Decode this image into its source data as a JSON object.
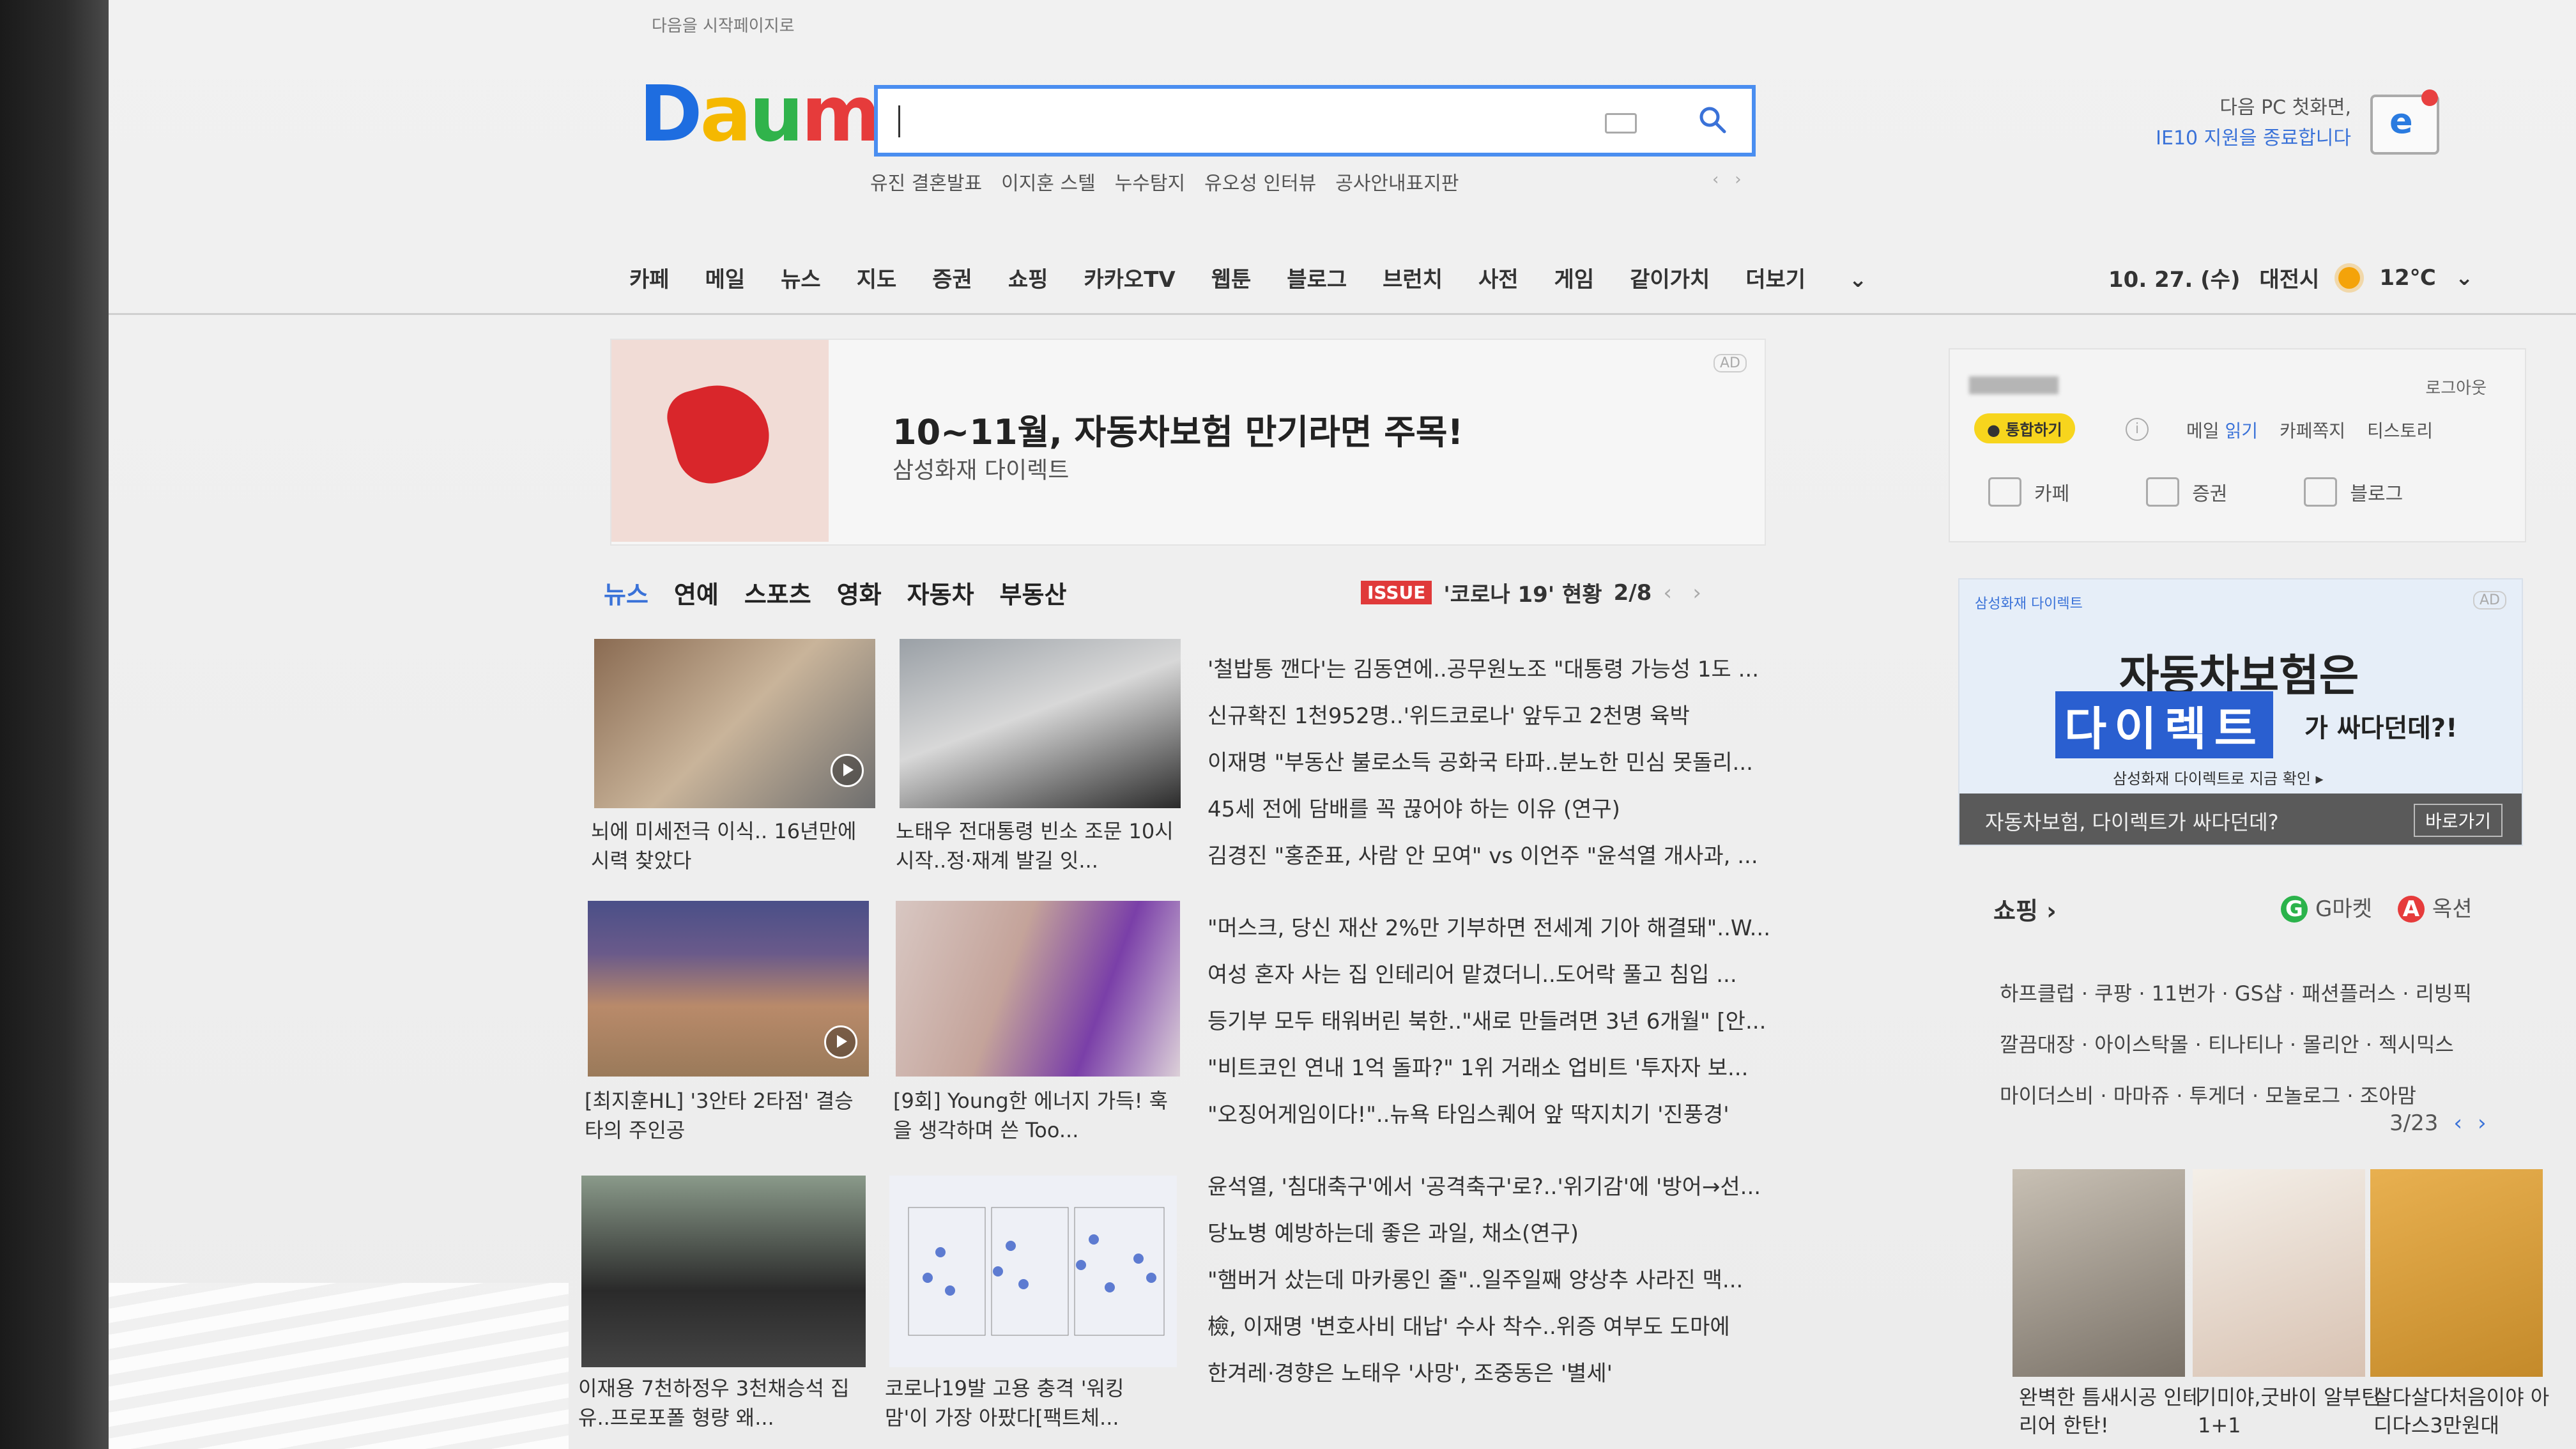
{
  "header": {
    "start_link": "다음을 시작페이지로",
    "logo_text": "Daum",
    "trending": [
      "유진 결혼발표",
      "이지훈 스텔",
      "누수탐지",
      "유오성 인터뷰",
      "공사안내표지판"
    ],
    "ie_notice_line1": "다음 PC 첫화면,",
    "ie_notice_line2": "IE10 지원을 종료합니다",
    "ie_icon_letter": "e"
  },
  "nav": {
    "items": [
      "카페",
      "메일",
      "뉴스",
      "지도",
      "증권",
      "쇼핑",
      "카카오TV",
      "웹툰",
      "블로그",
      "브런치",
      "사전",
      "게임",
      "같이가치",
      "더보기"
    ]
  },
  "weather": {
    "date": "10. 27. (수)",
    "location": "대전시",
    "temp": "12℃"
  },
  "ad_banner": {
    "title": "10~11월, 자동차보험 만기라면 주목!",
    "sub": "삼성화재 다이렉트",
    "badge": "AD"
  },
  "news_tabs": {
    "items": [
      "뉴스",
      "연예",
      "스포츠",
      "영화",
      "자동차",
      "부동산"
    ],
    "issue_badge": "ISSUE",
    "issue_text": "'코로나 19' 현황",
    "issue_page": "2/8"
  },
  "thumbs": [
    {
      "caption": "뇌에 미세전극 이식.. 16년만에 시력 찾았다"
    },
    {
      "caption": "노태우 전대통령 빈소 조문 10시 시작..정·재계 발길 잇..."
    },
    {
      "caption": "[최지훈HL] '3안타 2타점' 결승타의 주인공"
    },
    {
      "caption": "[9회] Young한 에너지 가득! 훅을 생각하며 쓴 Too..."
    },
    {
      "caption": "이재용 7천하정우 3천채승석 집유..프로포폴 형량 왜..."
    },
    {
      "caption": "코로나19발 고용 충격 '워킹맘'이 가장 아팠다[팩트체..."
    }
  ],
  "headlines": [
    "'철밥통 깬다'는 김동연에..공무원노조 \"대통령 가능성 1도 ...",
    "신규확진 1천952명..'위드코로나' 앞두고 2천명 육박",
    "이재명 \"부동산 불로소득 공화국 타파..분노한 민심 못돌리...",
    "45세 전에 담배를 꼭 끊어야 하는 이유 (연구)",
    "김경진 \"홍준표, 사람 안 모여\" vs 이언주 \"윤석열 개사과, ...",
    "\"머스크, 당신 재산 2%만 기부하면 전세계 기아 해결돼\"..W...",
    "여성 혼자 사는 집 인테리어 맡겼더니..도어락 풀고 침입 ...",
    "등기부 모두 태워버린 북한..\"새로 만들려면 3년 6개월\" [안...",
    "\"비트코인 연내 1억 돌파?\" 1위 거래소 업비트 '투자자 보...",
    "\"오징어게임이다!\"..뉴욕 타임스퀘어 앞 딱지치기 '진풍경'",
    "윤석열, '침대축구'에서 '공격축구'로?..'위기감'에 '방어→선...",
    "당뇨병 예방하는데 좋은 과일, 채소(연구)",
    "\"햄버거 샀는데 마카롱인 줄\"..일주일째 양상추 사라진 맥...",
    "檢, 이재명 '변호사비 대납' 수사 착수..위증 여부도 도마에",
    "한겨레·경향은 노태우 '사망', 조중동은 '별세'"
  ],
  "login_box": {
    "logout": "로그아웃",
    "integrate_btn": "통합하기",
    "info": "i",
    "mail_label": "메일",
    "mail_link": "읽기",
    "links": [
      "카페쪽지",
      "티스토리"
    ],
    "services": [
      "카페",
      "증권",
      "블로그"
    ]
  },
  "side_ad": {
    "brand": "삼성화재 다이렉트",
    "adtag": "AD",
    "headline1": "자동차보험은",
    "headline2": "다이렉트",
    "headline3": "가 싸다던데?!",
    "sub": "삼성화재 다이렉트로 지금 확인 ▸",
    "bar_text": "자동차보험, 다이렉트가 싸다던데?",
    "bar_btn": "바로가기"
  },
  "shopping": {
    "title": "쇼핑 ›",
    "gmarket": "G마켓",
    "auction": "옥션",
    "g_letter": "G",
    "a_letter": "A",
    "list_lines": [
      "하프클럽 · 쿠팡 · 11번가 · GS샵 · 패션플러스 · 리빙픽",
      "깔끔대장 · 아이스탁몰 · 티나티나 · 몰리안 · 젝시믹스",
      "마이더스비 · 마마쥬 · 투게더 · 모놀로그 · 조아맘"
    ],
    "page": "3/23",
    "products": [
      {
        "caption": "완벽한 틈새시공 인테리어 한탄!"
      },
      {
        "caption": "기미야,굿바이 알부틴 1+1"
      },
      {
        "caption": "살다살다처음이야 아디다스3만원대"
      }
    ]
  },
  "colors": {
    "brand_blue": "#3a72d8",
    "issue_red": "#e03a3a",
    "integrate_yellow": "#f7d51d"
  }
}
